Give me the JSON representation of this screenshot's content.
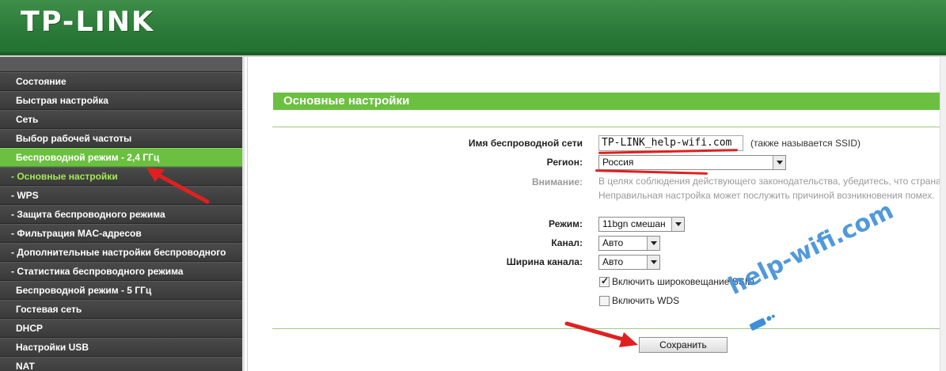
{
  "header": {
    "logo": "TP-LINK"
  },
  "sidebar": {
    "items": [
      {
        "label": "Состояние",
        "kind": "top"
      },
      {
        "label": "Быстрая настройка",
        "kind": "top"
      },
      {
        "label": "Сеть",
        "kind": "top"
      },
      {
        "label": "Выбор рабочей частоты",
        "kind": "top"
      },
      {
        "label": "Беспроводной режим - 2,4 ГГц",
        "kind": "active"
      },
      {
        "label": "- Основные настройки",
        "kind": "current"
      },
      {
        "label": "- WPS",
        "kind": "sub"
      },
      {
        "label": "- Защита беспроводного режима",
        "kind": "sub"
      },
      {
        "label": "- Фильтрация MAC-адресов",
        "kind": "sub"
      },
      {
        "label": "- Дополнительные настройки беспроводного",
        "kind": "sub"
      },
      {
        "label": "- Статистика беспроводного режима",
        "kind": "sub"
      },
      {
        "label": "Беспроводной режим - 5 ГГц",
        "kind": "top"
      },
      {
        "label": "Гостевая сеть",
        "kind": "top"
      },
      {
        "label": "DHCP",
        "kind": "top"
      },
      {
        "label": "Настройки USB",
        "kind": "top"
      },
      {
        "label": "NAT",
        "kind": "top"
      }
    ]
  },
  "main": {
    "title": "Основные настройки",
    "ssid": {
      "label": "Имя беспроводной сети",
      "value": "TP-LINK_help-wifi.com",
      "hint": "(также называется SSID)"
    },
    "region": {
      "label": "Регион:",
      "value": "Россия"
    },
    "warning": {
      "label": "Внимание:",
      "line1": "В целях соблюдения действующего законодательства, убедитесь, что страна в",
      "line2": "Неправильная настройка может послужить причиной возникновения помех."
    },
    "mode": {
      "label": "Режим:",
      "value": "11bgn смешан"
    },
    "channel": {
      "label": "Канал:",
      "value": "Авто"
    },
    "width": {
      "label": "Ширина канала:",
      "value": "Авто"
    },
    "ssid_broadcast": {
      "label": "Включить широковещание SSID",
      "checked": true
    },
    "wds": {
      "label": "Включить WDS",
      "checked": false
    },
    "save_label": "Сохранить"
  },
  "watermark": {
    "text": "help-wifi.com"
  },
  "colors": {
    "brand_green": "#2b7a39",
    "accent_green": "#6cc041",
    "annotation_red": "#e02020",
    "watermark_blue": "#3f8fd8"
  }
}
